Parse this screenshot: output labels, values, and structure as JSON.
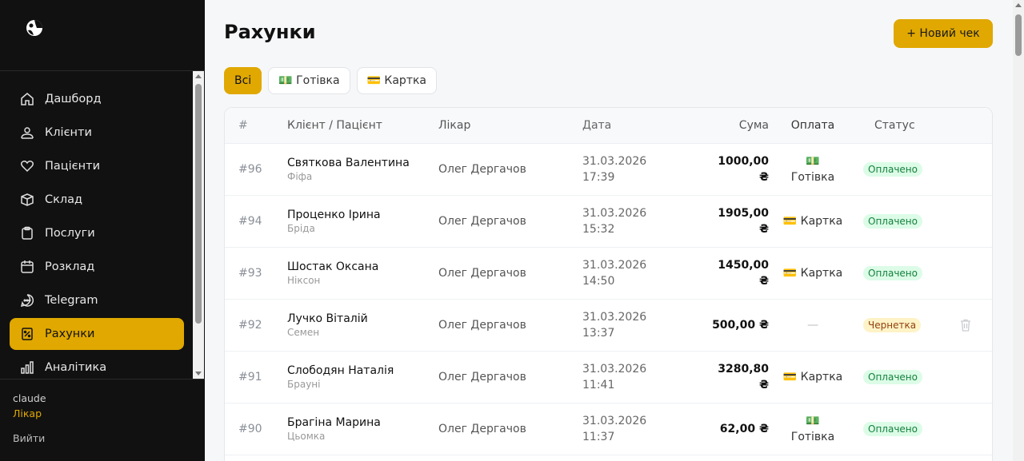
{
  "sidebar": {
    "items": [
      {
        "label": "Дашборд",
        "icon": "home-icon"
      },
      {
        "label": "Клієнти",
        "icon": "users-icon"
      },
      {
        "label": "Пацієнти",
        "icon": "heart-icon"
      },
      {
        "label": "Склад",
        "icon": "box-icon"
      },
      {
        "label": "Послуги",
        "icon": "clipboard-icon"
      },
      {
        "label": "Розклад",
        "icon": "calendar-icon"
      },
      {
        "label": "Telegram",
        "icon": "chat-icon"
      },
      {
        "label": "Рахунки",
        "icon": "receipt-icon",
        "active": true
      },
      {
        "label": "Аналітика",
        "icon": "chart-icon"
      }
    ],
    "user": {
      "name": "claude",
      "role": "Лікар",
      "logout": "Вийти"
    }
  },
  "header": {
    "title": "Рахунки",
    "new_button": "+ Новий чек"
  },
  "filters": [
    {
      "label": "Всі",
      "active": true
    },
    {
      "label": "💵 Готівка"
    },
    {
      "label": "💳 Картка"
    }
  ],
  "table": {
    "columns": [
      "#",
      "Клієнт / Пацієнт",
      "Лікар",
      "Дата",
      "Сума",
      "Оплата",
      "Статус"
    ],
    "rows": [
      {
        "num": "#96",
        "client": "Святкова Валентина",
        "patient": "Фіфа",
        "doctor": "Олег Дергачов",
        "date": "31.03.2026",
        "time": "17:39",
        "sum1": "1000,00",
        "sum2": "₴",
        "pay1": "💵",
        "pay2": "Готівка",
        "status": "Оплачено",
        "status_type": "paid"
      },
      {
        "num": "#94",
        "client": "Проценко Ірина",
        "patient": "Бріда",
        "doctor": "Олег Дергачов",
        "date": "31.03.2026",
        "time": "15:32",
        "sum1": "1905,00",
        "sum2": "₴",
        "pay1": "💳 Картка",
        "pay2": "",
        "status": "Оплачено",
        "status_type": "paid"
      },
      {
        "num": "#93",
        "client": "Шостак Оксана",
        "patient": "Ніксон",
        "doctor": "Олег Дергачов",
        "date": "31.03.2026",
        "time": "14:50",
        "sum1": "1450,00",
        "sum2": "₴",
        "pay1": "💳 Картка",
        "pay2": "",
        "status": "Оплачено",
        "status_type": "paid"
      },
      {
        "num": "#92",
        "client": "Лучко Віталій",
        "patient": "Семен",
        "doctor": "Олег Дергачов",
        "date": "31.03.2026",
        "time": "13:37",
        "sum1": "500,00 ₴",
        "sum2": "",
        "pay1": "—",
        "pay2": "",
        "status": "Чернетка",
        "status_type": "draft"
      },
      {
        "num": "#91",
        "client": "Слободян Наталія",
        "patient": "Брауні",
        "doctor": "Олег Дергачов",
        "date": "31.03.2026",
        "time": "11:41",
        "sum1": "3280,80",
        "sum2": "₴",
        "pay1": "💳 Картка",
        "pay2": "",
        "status": "Оплачено",
        "status_type": "paid"
      },
      {
        "num": "#90",
        "client": "Брагіна Марина",
        "patient": "Цьомка",
        "doctor": "Олег Дергачов",
        "date": "31.03.2026",
        "time": "11:37",
        "sum1": "62,00 ₴",
        "sum2": "",
        "pay1": "💵",
        "pay2": "Готівка",
        "status": "Оплачено",
        "status_type": "paid"
      }
    ]
  },
  "colors": {
    "accent": "#e0a800",
    "sidebar_bg": "#111111",
    "paid_bg": "#dcfce7",
    "draft_bg": "#fef3c7"
  }
}
